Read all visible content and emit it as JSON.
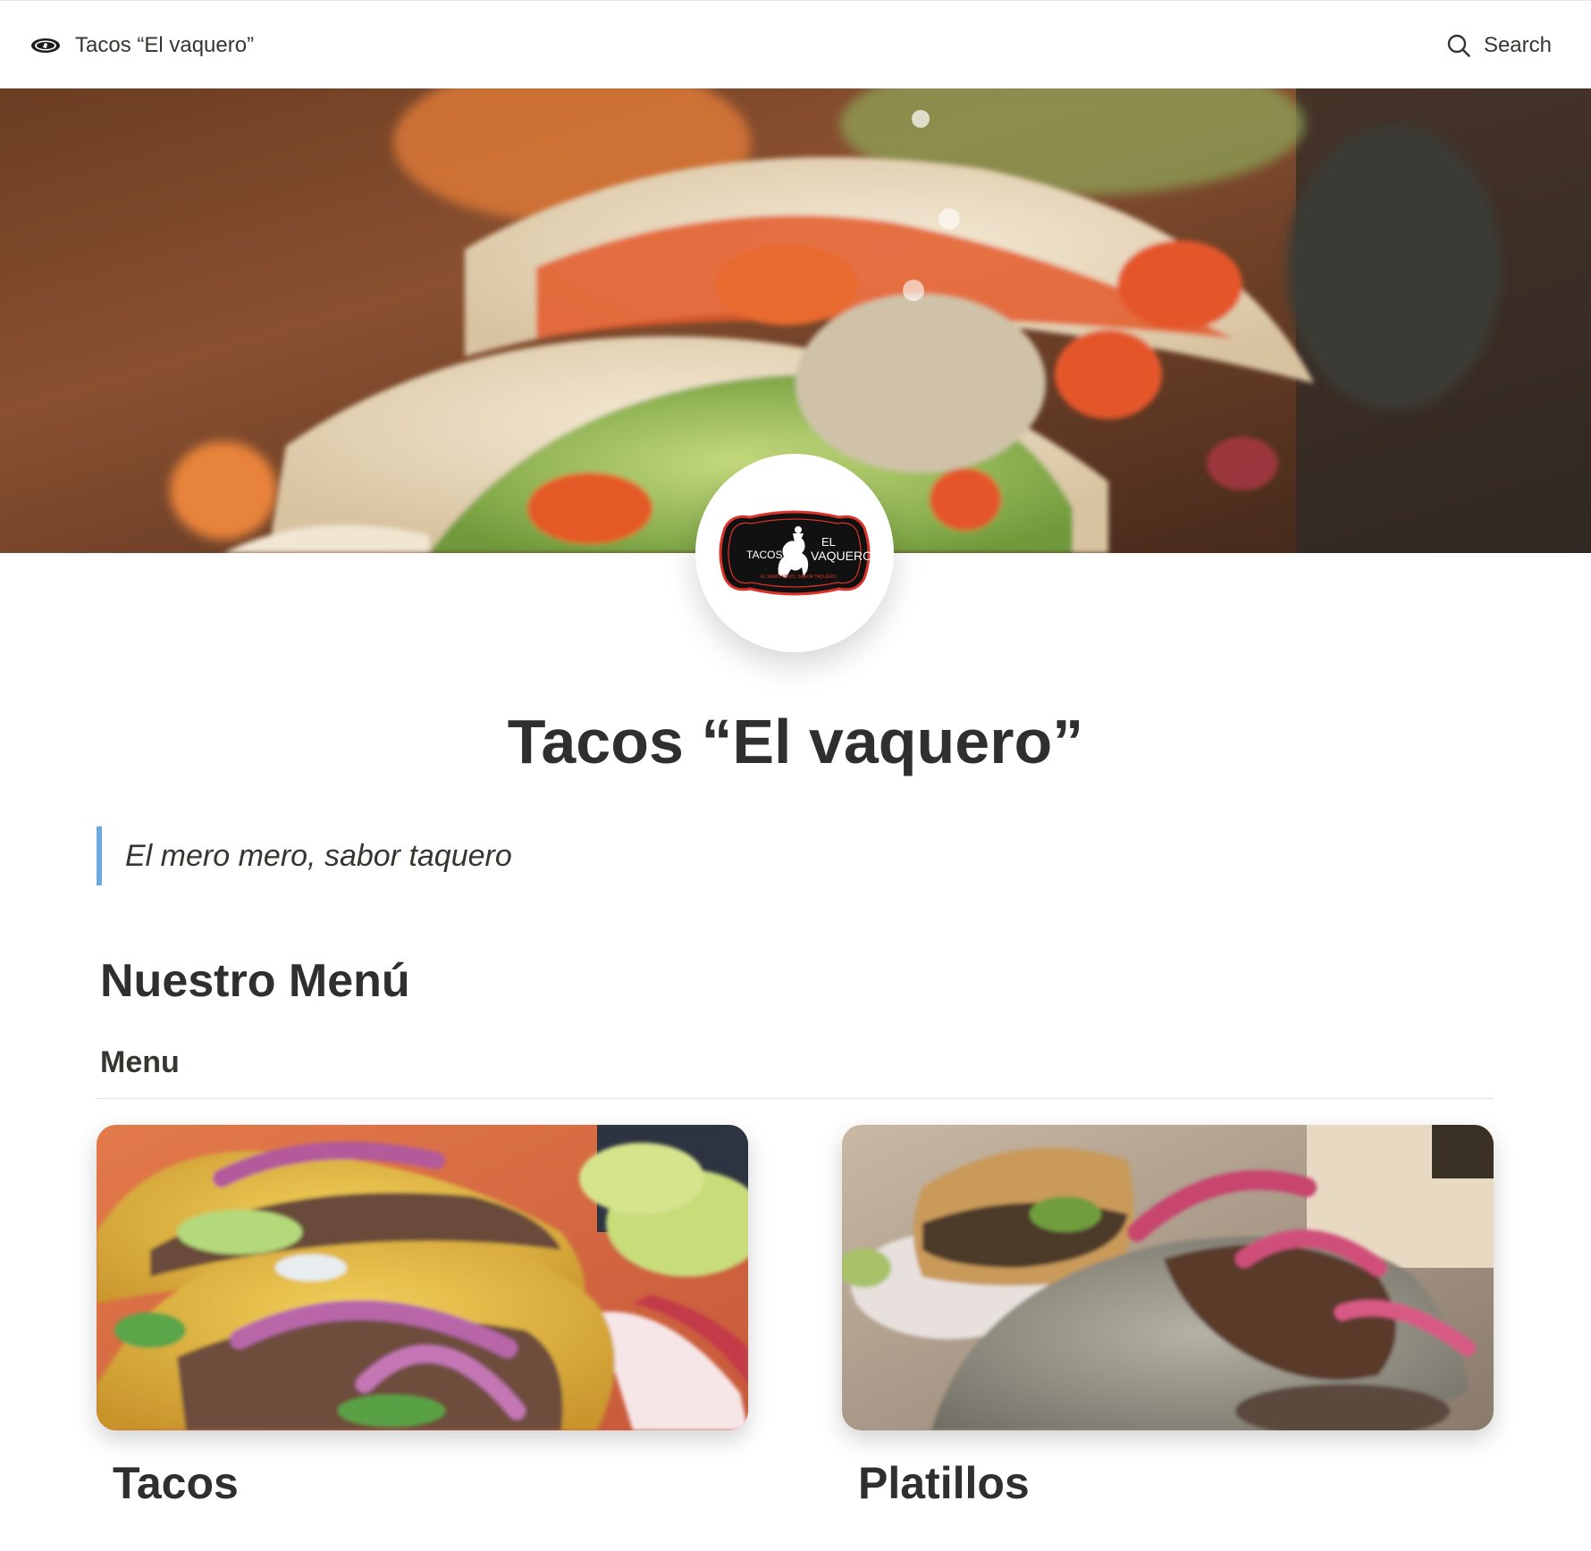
{
  "header": {
    "site_title": "Tacos “El vaquero”",
    "search_label": "Search",
    "icons": [
      "logo-icon",
      "search-icon"
    ]
  },
  "cover": {
    "image": "close-up of tacos with avocado and tomato",
    "logo": {
      "text_left": "TACOS",
      "text_right_1": "EL",
      "text_right_2": "VAQUERO",
      "tagline": "EL MERO MERO, SABOR TAQUERO"
    }
  },
  "page": {
    "title": "Tacos “El vaquero”",
    "quote": "El mero mero, sabor taquero",
    "section_heading": "Nuestro Menú"
  },
  "database": {
    "title": "Menu",
    "cards": [
      {
        "title": "Tacos"
      },
      {
        "title": "Platillos"
      }
    ]
  },
  "colors": {
    "accent_quote_bar": "#6ea8e0",
    "text": "#37352f",
    "logo_red": "#d9332a"
  }
}
